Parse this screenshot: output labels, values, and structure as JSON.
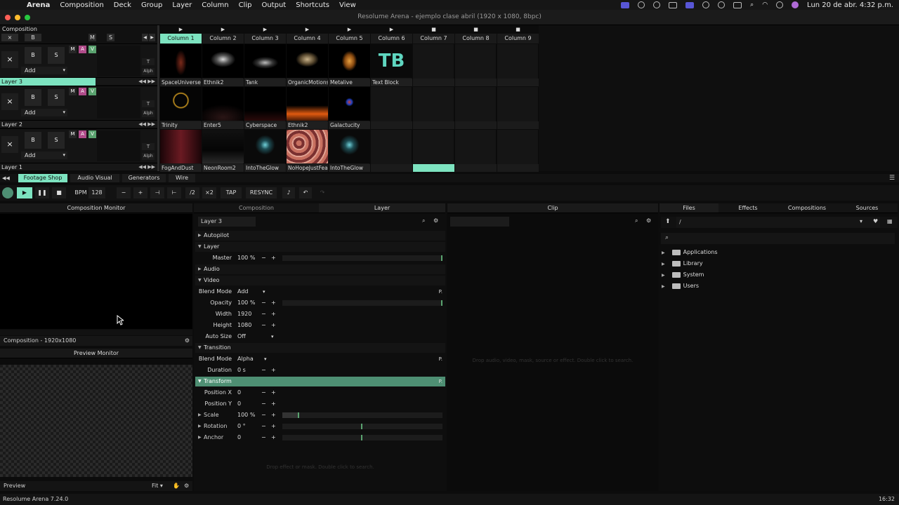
{
  "menubar": {
    "items": [
      "Arena",
      "Composition",
      "Deck",
      "Group",
      "Layer",
      "Column",
      "Clip",
      "Output",
      "Shortcuts",
      "View"
    ],
    "datetime": "Lun 20 de abr.  4:32 p.m."
  },
  "window": {
    "title": "Resolume Arena - ejemplo clase abril (1920 x 1080, 8bpc)"
  },
  "composition": {
    "header": "Composition",
    "top_buttons": {
      "x": "×",
      "b": "B",
      "m": "M",
      "s": "S"
    },
    "layers": [
      {
        "label": "Layer 3",
        "add": "Add",
        "x": "×",
        "b": "B",
        "s": "S",
        "m": "M",
        "a": "A",
        "v": "V",
        "t": "T",
        "alph": "Alph",
        "skip": "◀◀ ▶▶"
      },
      {
        "label": "Layer 2",
        "add": "Add",
        "x": "×",
        "b": "B",
        "s": "S",
        "m": "M",
        "a": "A",
        "v": "V",
        "t": "T",
        "alph": "Alph",
        "skip": "◀◀ ▶▶"
      },
      {
        "label": "Layer 1",
        "add": "Add",
        "x": "×",
        "b": "B",
        "s": "S",
        "m": "M",
        "a": "A",
        "v": "V",
        "t": "T",
        "alph": "Alph",
        "skip": "◀◀ ▶▶"
      }
    ],
    "columns": [
      "Column 1",
      "Column 2",
      "Column 3",
      "Column 4",
      "Column 5",
      "Column 6",
      "Column 7",
      "Column 8",
      "Column 9"
    ],
    "column_triggers": [
      "▶",
      "▶",
      "▶",
      "▶",
      "▶",
      "▶",
      "■",
      "■",
      "■"
    ],
    "clips": {
      "layer3": [
        "SpaceUniverse",
        "Ethnik2",
        "Tank",
        "OrganicMotions",
        "Metalive",
        "Text Block",
        "",
        "",
        ""
      ],
      "layer2": [
        "Trinity",
        "Enter5",
        "Cyberspace",
        "Ethnik2",
        "Galactucity",
        "",
        "",
        "",
        ""
      ],
      "layer1": [
        "FogAndDust",
        "NeonRoom2",
        "IntoTheGlow",
        "NoHopeJustFear",
        "IntoTheGlow",
        "",
        "",
        "",
        ""
      ]
    },
    "text_block_glyph": "TB"
  },
  "source_tabs": [
    "Footage Shop",
    "Audio Visual",
    "Generators",
    "Wire"
  ],
  "transport": {
    "bpm_label": "BPM",
    "bpm": "128",
    "minus": "−",
    "plus": "+",
    "nudge_left": "⊣",
    "nudge_right": "⊢",
    "half": "/2",
    "double": "×2",
    "tap": "TAP",
    "resync": "RESYNC"
  },
  "comp_monitor": {
    "title": "Composition Monitor",
    "footer": "Composition - 1920x1080",
    "preview_title": "Preview Monitor",
    "preview_label": "Preview",
    "fit": "Fit"
  },
  "layer_panel": {
    "tabs": [
      "Composition",
      "Layer"
    ],
    "layer_name": "Layer 3",
    "sections": {
      "autopilot": "Autopilot",
      "layer": "Layer",
      "audio": "Audio",
      "video": "Video",
      "transition": "Transition",
      "transform": "Transform"
    },
    "p_badge": "P.",
    "params": {
      "master": {
        "label": "Master",
        "value": "100 %"
      },
      "blend_mode": {
        "label": "Blend Mode",
        "value": "Add"
      },
      "opacity": {
        "label": "Opacity",
        "value": "100 %"
      },
      "width": {
        "label": "Width",
        "value": "1920"
      },
      "height": {
        "label": "Height",
        "value": "1080"
      },
      "auto_size": {
        "label": "Auto Size",
        "value": "Off"
      },
      "trans_blend": {
        "label": "Blend Mode",
        "value": "Alpha"
      },
      "duration": {
        "label": "Duration",
        "value": "0 s"
      },
      "position_x": {
        "label": "Position X",
        "value": "0"
      },
      "position_y": {
        "label": "Position Y",
        "value": "0"
      },
      "scale": {
        "label": "Scale",
        "value": "100 %"
      },
      "rotation": {
        "label": "Rotation",
        "value": "0 °"
      },
      "anchor": {
        "label": "Anchor",
        "value": "0"
      }
    },
    "minus": "−",
    "plus": "+",
    "drop_hint": "Drop effect or mask. Double click to search."
  },
  "clip_panel": {
    "title": "Clip",
    "drop_hint": "Drop audio, video, mask, source or effect. Double click to search."
  },
  "files_panel": {
    "tabs": [
      "Files",
      "Effects",
      "Compositions",
      "Sources"
    ],
    "path": "/",
    "items": [
      "Applications",
      "Library",
      "System",
      "Users"
    ]
  },
  "statusbar": {
    "version": "Resolume Arena 7.24.0",
    "time": "16:32"
  },
  "colors": {
    "accent": "#7de3c0",
    "transform_active": "#4e8f73",
    "mute_pink": "#b04c8a",
    "video_green": "#5aa36f"
  }
}
